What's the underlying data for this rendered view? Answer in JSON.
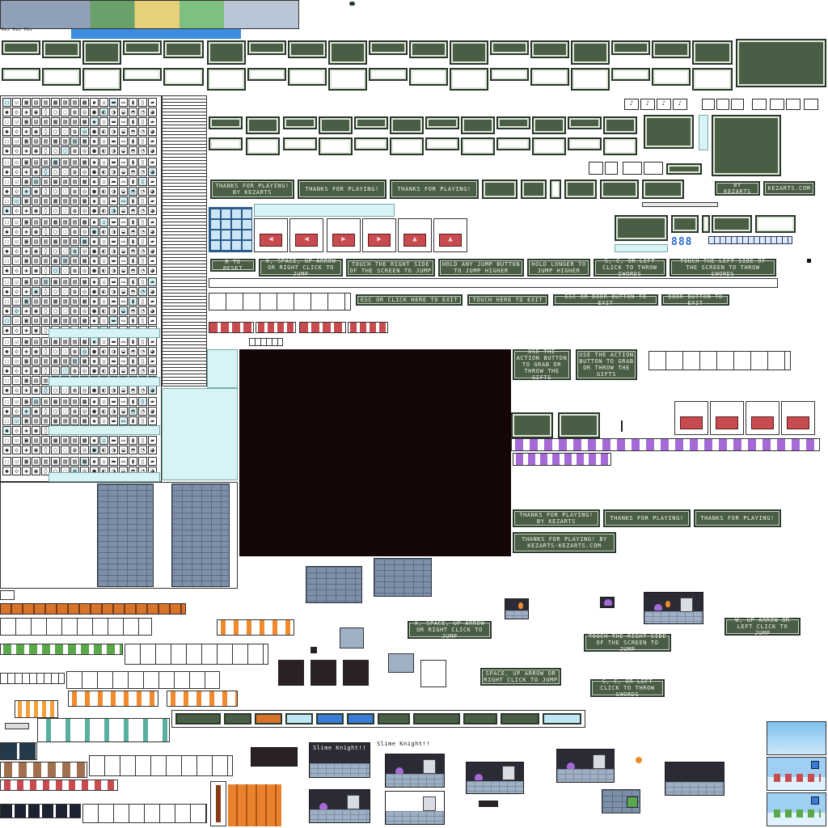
{
  "colors": {
    "panel_dark": "#4a5d45",
    "panel_border": "#28372a",
    "button_red": "#c84b50",
    "brick": "#7e8fa8",
    "canvas_dark": "#140606",
    "cyan_fill": "#d8f3f6",
    "orange": "#d8732a",
    "blue": "#3a7bd5"
  },
  "header": {
    "tiny_credit": "Kez Kez Kez"
  },
  "buttons": {
    "thanks_1": "Thanks for playing! by Kezarts",
    "thanks_2": "Thanks for playing!",
    "thanks_3": "Thanks for playing!",
    "by_kezarts": "By Kezarts",
    "kezarts_com": "Kezarts.com",
    "r_reset": "R to reset",
    "jump_1": "X, space, up arrow or right click to jump",
    "touch_right": "Touch the right side of the screen to jump",
    "hold_jump": "Hold any jump button to jump higher",
    "hold_longer": "Hold longer to jump higher",
    "throw_1": "S, C, or left click to throw swords",
    "touch_left": "Touch the left side of the screen to throw swords",
    "esc_exit": "Esc or click here to exit",
    "touch_exit": "Touch here to exit",
    "esc_door_exit": "Esc or door button to exit",
    "door_exit": "Door button to exit",
    "action_gifts_1": "Use the action button to grab or throw the gifts",
    "action_gifts_2": "Use the action button to grab or throw the gifts",
    "thanks_4": "Thanks for playing! by Kezarts",
    "thanks_5": "Thanks for playing!",
    "thanks_6": "Thanks for playing!",
    "thanks_7": "Thanks for playing! by Kezarts-Kezarts.com",
    "jump_2": "X, space, up arrow or right click to jump",
    "touch_right_2": "Touch the right side of the screen to jump",
    "space_jump": "Space, up arrow or right click to jump",
    "throw_2": "S, C, or left click to throw swords",
    "w_up": "W, up arrow or left click to jump"
  },
  "titles": {
    "slime_knight_1": "Slime Knight!!",
    "slime_knight_2": "Slime Knight!!"
  },
  "glyph_rows": [
    "☐☑▣▤▥▦▧▨▩▪▫▬▭▮▯▰",
    "◆◇◈◉◊○◌◍◎●◐◑◒◓◔◕"
  ],
  "icons": {
    "arrow_left": "◀",
    "arrow_right": "▶",
    "arrow_up": "▲",
    "music_note": "♪"
  }
}
